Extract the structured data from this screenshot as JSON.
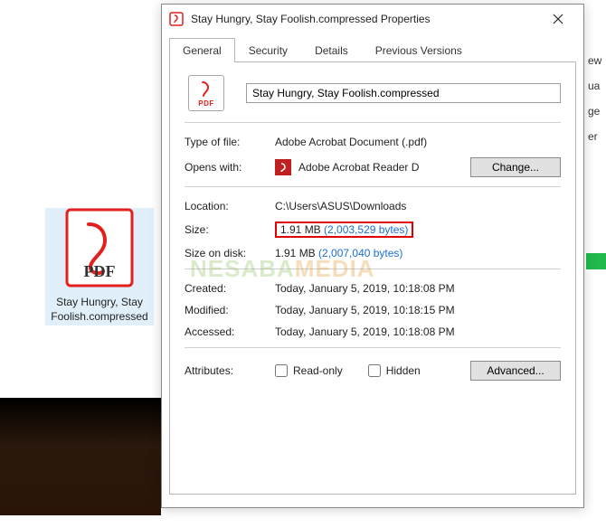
{
  "desktop": {
    "item_label": "Stay Hungry, Stay Foolish.compressed"
  },
  "dialog": {
    "title": "Stay Hungry, Stay Foolish.compressed Properties",
    "tabs": [
      "General",
      "Security",
      "Details",
      "Previous Versions"
    ],
    "icon_sub": "PDF",
    "filename": "Stay Hungry, Stay Foolish.compressed",
    "type_label": "Type of file:",
    "type_value": "Adobe Acrobat Document (.pdf)",
    "opens_label": "Opens with:",
    "opens_value": "Adobe Acrobat Reader D",
    "change_btn": "Change...",
    "location_label": "Location:",
    "location_value": "C:\\Users\\ASUS\\Downloads",
    "size_label": "Size:",
    "size_value": "1.91 MB ",
    "size_bytes": "(2,003,529 bytes)",
    "sizeod_label": "Size on disk:",
    "sizeod_value": "1.91 MB ",
    "sizeod_bytes": "(2,007,040 bytes)",
    "created_label": "Created:",
    "created_value": "Today, January 5, 2019, 10:18:08 PM",
    "modified_label": "Modified:",
    "modified_value": "Today, January 5, 2019, 10:18:15 PM",
    "accessed_label": "Accessed:",
    "accessed_value": "Today, January 5, 2019, 10:18:08 PM",
    "attributes_label": "Attributes:",
    "attr_readonly": "Read-only",
    "attr_hidden": "Hidden",
    "advanced_btn": "Advanced..."
  },
  "watermark": {
    "p1": "NESABA",
    "p2": "MEDIA"
  },
  "edge": {
    "a": "ew",
    "b": "ua",
    "c": "ge",
    "d": "er"
  }
}
